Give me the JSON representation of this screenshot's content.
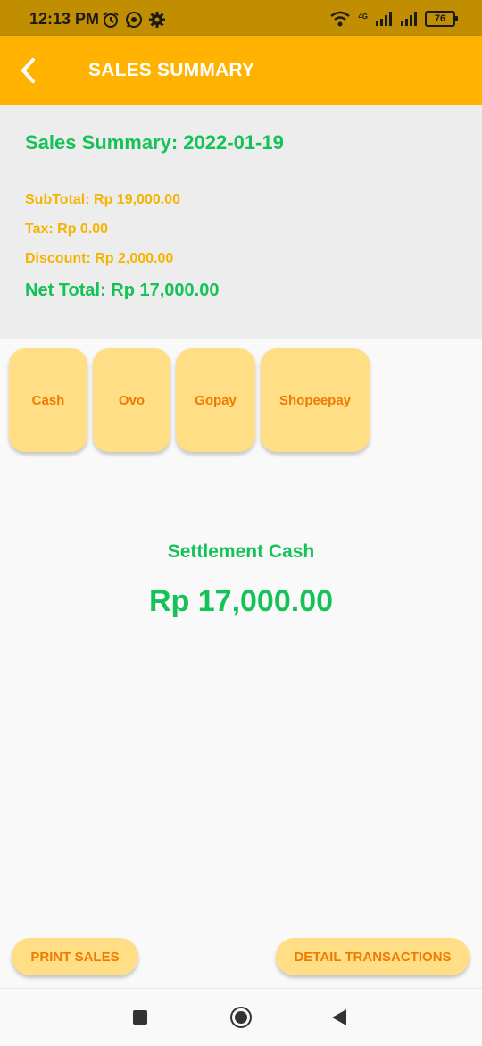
{
  "status_bar": {
    "time": "12:13 PM",
    "network": "4G",
    "battery": "76",
    "icons": [
      "alarm-icon",
      "whatsapp-icon",
      "settings-gear-icon",
      "wifi-icon",
      "signal-icon",
      "battery-icon"
    ]
  },
  "app_bar": {
    "title": "SALES SUMMARY",
    "back_icon": "chevron-left-icon",
    "color": "#ffb300"
  },
  "summary": {
    "heading": "Sales Summary: 2022-01-19",
    "subtotal": "SubTotal: Rp 19,000.00",
    "tax": "Tax: Rp 0.00",
    "discount": "Discount: Rp 2,000.00",
    "net_total": "Net Total: Rp 17,000.00"
  },
  "payment_tabs": [
    {
      "label": "Cash"
    },
    {
      "label": "Ovo"
    },
    {
      "label": "Gopay"
    },
    {
      "label": "Shopeepay"
    }
  ],
  "settlement": {
    "label": "Settlement Cash",
    "amount": "Rp 17,000.00"
  },
  "actions": {
    "print_label": "PRINT SALES",
    "detail_label": "DETAIL TRANSACTIONS"
  },
  "colors": {
    "green": "#14c257",
    "orange_text": "#ee7b00",
    "yellow_text": "#f4b400",
    "button_bg": "#ffde85"
  },
  "nav_bar": {
    "icons": [
      "recent-apps-icon",
      "home-icon",
      "back-triangle-icon"
    ]
  }
}
